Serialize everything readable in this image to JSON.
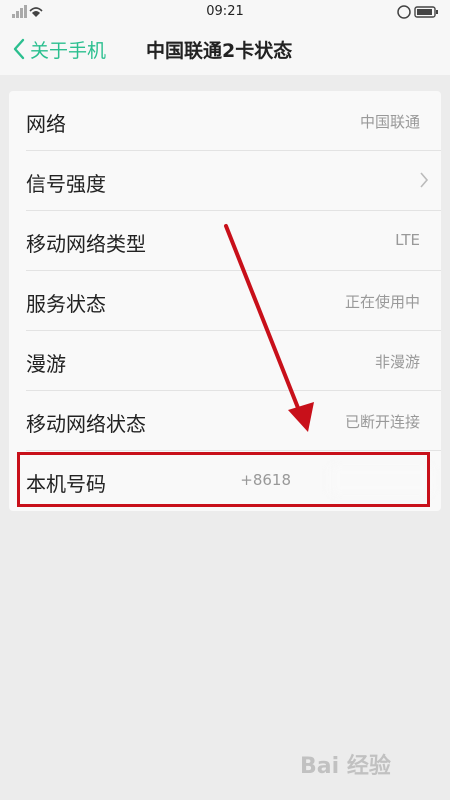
{
  "status_bar": {
    "time": "09:21"
  },
  "nav": {
    "back_label": "关于手机",
    "title": "中国联通2卡状态"
  },
  "rows": [
    {
      "label": "网络",
      "value": "中国联通"
    },
    {
      "label": "信号强度",
      "value": ""
    },
    {
      "label": "移动网络类型",
      "value": "LTE"
    },
    {
      "label": "服务状态",
      "value": "正在使用中"
    },
    {
      "label": "漫游",
      "value": "非漫游"
    },
    {
      "label": "移动网络状态",
      "value": "已断开连接"
    },
    {
      "label": "本机号码",
      "value": "+8618"
    }
  ],
  "watermark": {
    "text": "Bai 经验"
  },
  "colors": {
    "accent": "#2bbf8f",
    "highlight": "#c8101a"
  }
}
